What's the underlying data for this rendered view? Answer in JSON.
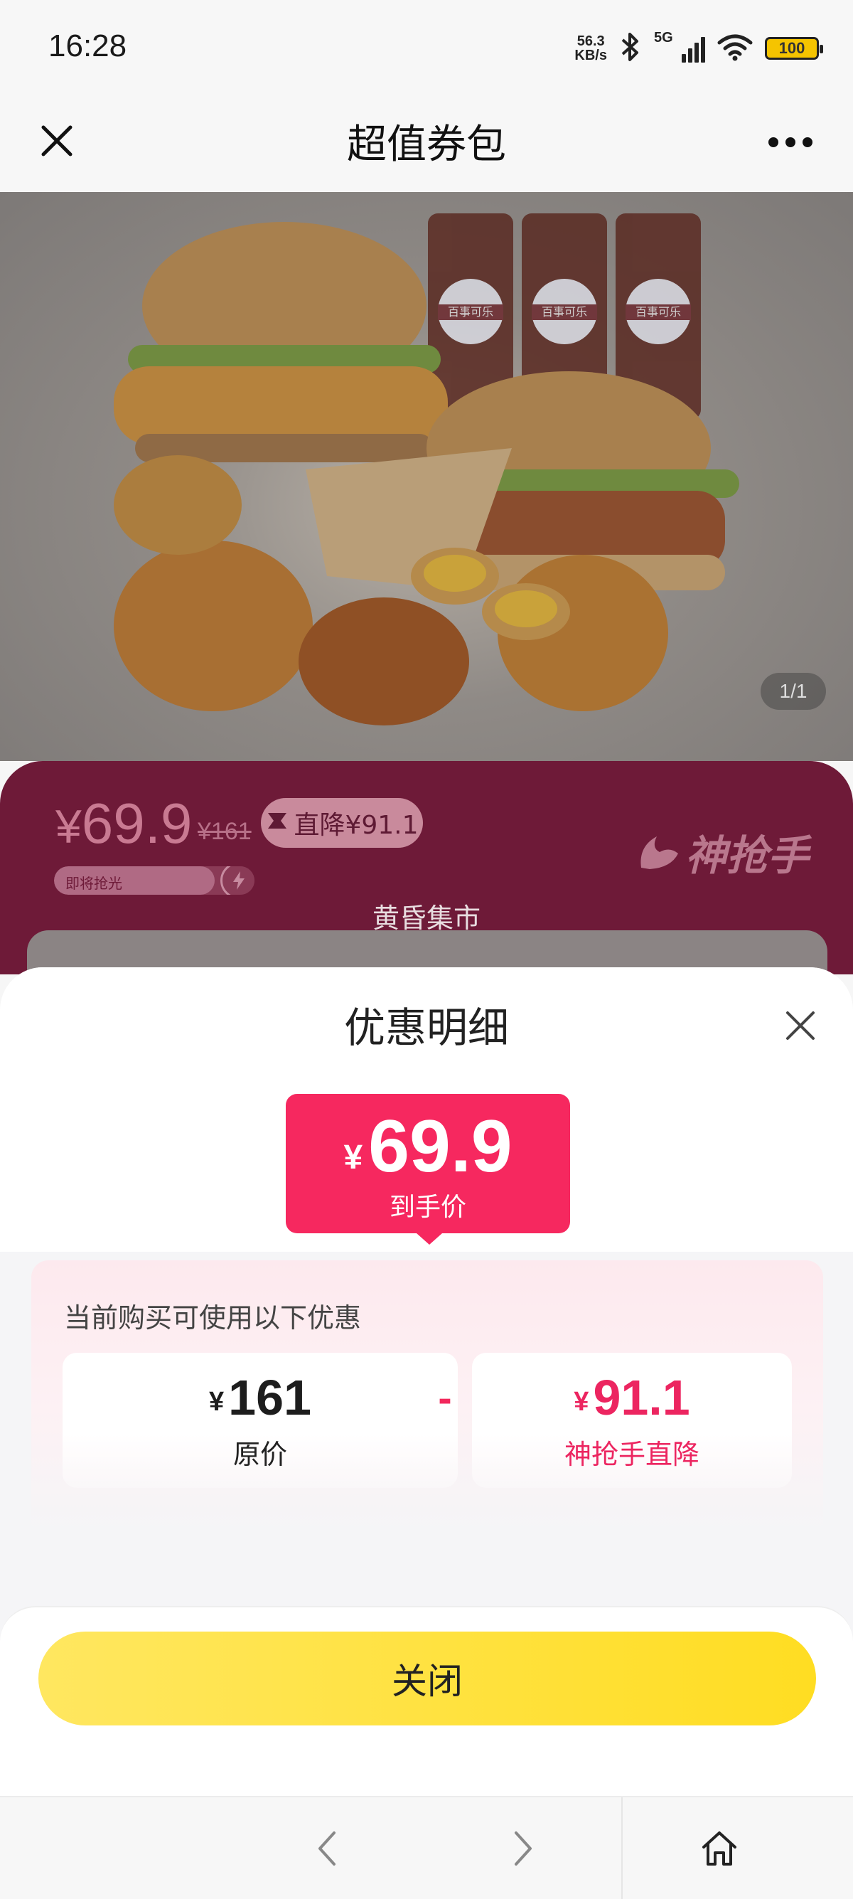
{
  "status_bar": {
    "time": "16:28",
    "net_speed_value": "56.3",
    "net_speed_unit": "KB/s",
    "network_type": "5G",
    "battery_level": "100"
  },
  "nav": {
    "title": "超值券包"
  },
  "hero": {
    "page_indicator": "1/1",
    "cup_label": "百事可乐"
  },
  "price_banner": {
    "price_yen": "¥",
    "price_value": "69.9",
    "original_price": "¥161",
    "drop_label": "直降¥91.1",
    "stock_label": "即将抢光",
    "stock_level_fraction": 0.8,
    "brand": "神抢手",
    "market_label": "黄昏集市"
  },
  "sheet": {
    "title": "优惠明细",
    "final_price_yen": "¥",
    "final_price_value": "69.9",
    "final_price_label": "到手价",
    "panel_caption": "当前购买可使用以下优惠",
    "original_card": {
      "yen": "¥",
      "value": "161",
      "label": "原价"
    },
    "operator": "-",
    "discount_card": {
      "yen": "¥",
      "value": "91.1",
      "label": "神抢手直降"
    },
    "close_button_label": "关闭"
  },
  "colors": {
    "accent_pink": "#f6285f",
    "button_yellow": "#ffdd22",
    "banner_maroon": "#6e1a38"
  },
  "icons": {
    "nav_close": "close-icon",
    "nav_more": "more-icon",
    "sheet_close": "close-icon",
    "toolbar_back": "chevron-left-icon",
    "toolbar_forward": "chevron-right-icon",
    "toolbar_home": "home-icon"
  }
}
